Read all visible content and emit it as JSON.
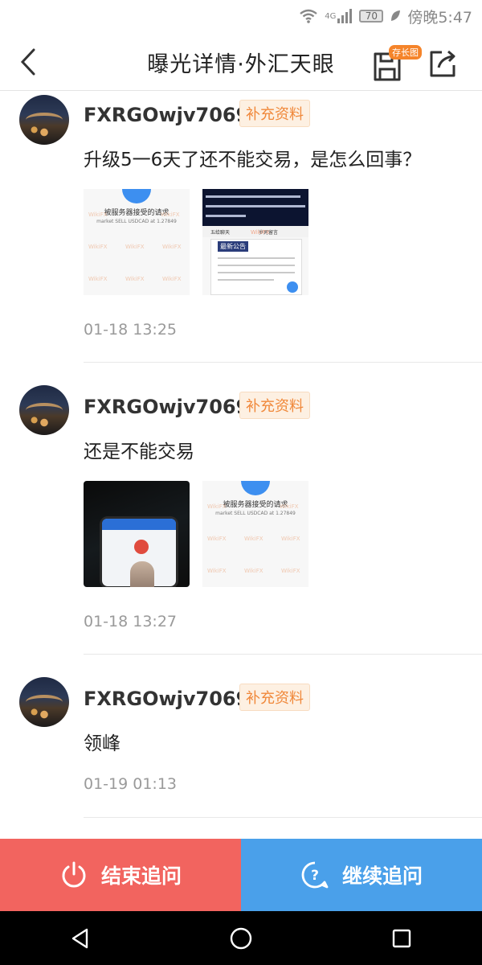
{
  "status_bar": {
    "network": "4G",
    "battery": "70",
    "time": "傍晚5:47"
  },
  "header": {
    "title": "曝光详情·外汇天眼",
    "save_badge": "存长图"
  },
  "posts": [
    {
      "username": "FXRGOwjv7069",
      "badge": "补充资料",
      "content": "升级5一6天了还不能交易，是怎么回事？",
      "time": "01-18 13:25",
      "images": [
        {
          "title": "被服务器接受的请求",
          "subtitle": "market SELL USDCAD at 1.27849"
        },
        {
          "tabs": [
            "五给聊天",
            "岁死留言"
          ],
          "notice": "最新公告"
        }
      ]
    },
    {
      "username": "FXRGOwjv7069",
      "badge": "补充资料",
      "content": "还是不能交易",
      "time": "01-18 13:27",
      "images": [
        {
          "type": "photo"
        },
        {
          "title": "被服务器接受的请求",
          "subtitle": "market SELL USDCAD at 1.27849"
        }
      ]
    },
    {
      "username": "FXRGOwjv7069",
      "badge": "补充资料",
      "content": "领峰",
      "time": "01-19 01:13"
    }
  ],
  "watermark": "WikiFX",
  "actions": {
    "end": "结束追问",
    "continue": "继续追问"
  },
  "colors": {
    "end_bg": "#f2645f",
    "continue_bg": "#4aa0ea",
    "badge_text": "#f0883a"
  }
}
